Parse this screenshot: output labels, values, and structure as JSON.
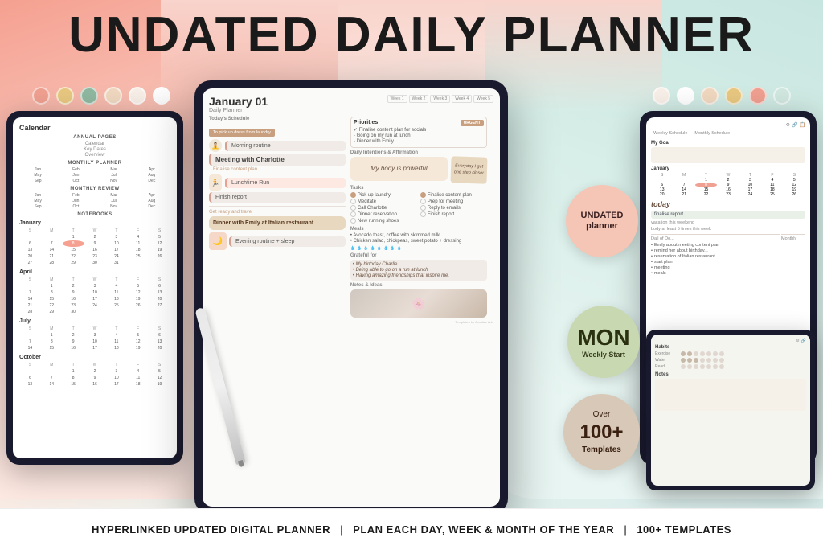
{
  "title": "UNDATED DAILY PLANNER",
  "footer": {
    "text1": "HYPERLINKED UPDATED DIGITAL PLANNER",
    "text2": "PLAN EACH DAY, WEEK & MONTH OF THE YEAR",
    "text3": "100+ TEMPLATES",
    "separator": "|"
  },
  "dots_left": [
    "#f0a090",
    "#e8c880",
    "#90b8a0",
    "#f0d8c0",
    "#f8f0e8",
    "#ffffff"
  ],
  "dots_right": [
    "#f8f0e8",
    "#ffffff",
    "#f0d8c0",
    "#e8c880",
    "#f0a090",
    "#d0e8e0"
  ],
  "badges": {
    "undated": {
      "line1": "UNDATED",
      "line2": "planner"
    },
    "mon": {
      "day": "MON",
      "line2": "Weekly Start"
    },
    "templates": {
      "over": "Over",
      "number": "100+",
      "label": "Templates"
    }
  },
  "center_planner": {
    "date": "January 01",
    "subtitle": "Daily Planner",
    "week_tabs": [
      "Week 1",
      "Week 2",
      "Week 3",
      "Week 4",
      "Week 5"
    ],
    "schedule_section": "Today's Schedule",
    "schedule_note": "To pick up dress from laundry",
    "items": [
      {
        "time": "",
        "label": "Morning routine",
        "type": "normal"
      },
      {
        "time": "",
        "label": "Meeting with Charlotte",
        "type": "bold"
      },
      {
        "time": "",
        "label": "Finalise content plan",
        "type": "sub"
      },
      {
        "time": "",
        "label": "Lunchtime Run",
        "type": "normal"
      },
      {
        "time": "",
        "label": "Finish report",
        "type": "normal"
      }
    ],
    "priorities": {
      "title": "Priorities",
      "badge": "URGENT",
      "items": [
        "Finalise content plan for socials",
        "Going on my run at lunch",
        "Dinner with Emily"
      ]
    },
    "affirmation": {
      "title": "Daily Intentions & Affirmation",
      "text": "My body is powerful",
      "sticker": "Everyday I get one step closer"
    },
    "tasks": {
      "title": "Tasks",
      "left": [
        "Pick up laundry",
        "Meditate",
        "Call Charlotte",
        "Dinner reservation",
        "New running shoes"
      ],
      "right": [
        "Finalise content plan",
        "Prep for meeting",
        "Reply to emails",
        "Finish report"
      ]
    },
    "meals": {
      "title": "Meals",
      "items": [
        "Avocado toast, coffee with skimmed milk",
        "Chicken salad, chickpeas, sweet potato + dressing"
      ]
    },
    "grateful": {
      "title": "Grateful for",
      "items": [
        "My birthday Charlie...",
        "Being able to go on a run at lunch",
        "Having amazing friendships that inspire me."
      ]
    },
    "notes": {
      "title": "Notes & Ideas"
    },
    "evening": "Evening routine + sleep",
    "dinner": "Dinner with Emily\nat Italian restaurant"
  },
  "left_device": {
    "title": "Calendar",
    "annual": {
      "title": "ANNUAL PAGES",
      "links": [
        "Calendar",
        "Key Dates",
        "Overview"
      ]
    },
    "monthly_planner": {
      "title": "MONTHLY PLANNER",
      "months": [
        "Jan",
        "Feb",
        "Mar",
        "Apr",
        "May",
        "Jun",
        "Jul",
        "Aug",
        "Sep",
        "Oct",
        "Nov",
        "Dec"
      ]
    },
    "monthly_review": {
      "title": "MONTHLY REVIEW",
      "months": [
        "Jan",
        "Feb",
        "Mar",
        "Apr",
        "May",
        "Jun",
        "Jul",
        "Aug",
        "Sep",
        "Oct",
        "Nov",
        "Dec"
      ]
    },
    "notebooks": {
      "title": "NOTEBOOKS"
    },
    "calendars": [
      {
        "month": "January",
        "days": [
          "1",
          "2",
          "3",
          "4",
          "5",
          "6",
          "7",
          "8",
          "9",
          "10",
          "11",
          "12",
          "13",
          "14",
          "15",
          "16",
          "17",
          "18",
          "19",
          "20",
          "21",
          "22",
          "23",
          "24",
          "25",
          "26",
          "27",
          "28",
          "29",
          "30",
          "31"
        ]
      },
      {
        "month": "April"
      },
      {
        "month": "July"
      },
      {
        "month": "October"
      }
    ]
  },
  "right_device": {
    "goal_title": "My Goal",
    "calendar_title": "January",
    "schedule_items": [
      "finalise report",
      "vacation this weekend",
      "body at least 5 times this week"
    ],
    "notes_items": [
      "Emily about meeting content plan",
      "remind her about birthday...",
      "reservation of Italian restaurant",
      "start plan",
      "meeting",
      "meals"
    ]
  },
  "small_device": {
    "sections": [
      "Habits",
      "Water",
      "Notes"
    ]
  }
}
